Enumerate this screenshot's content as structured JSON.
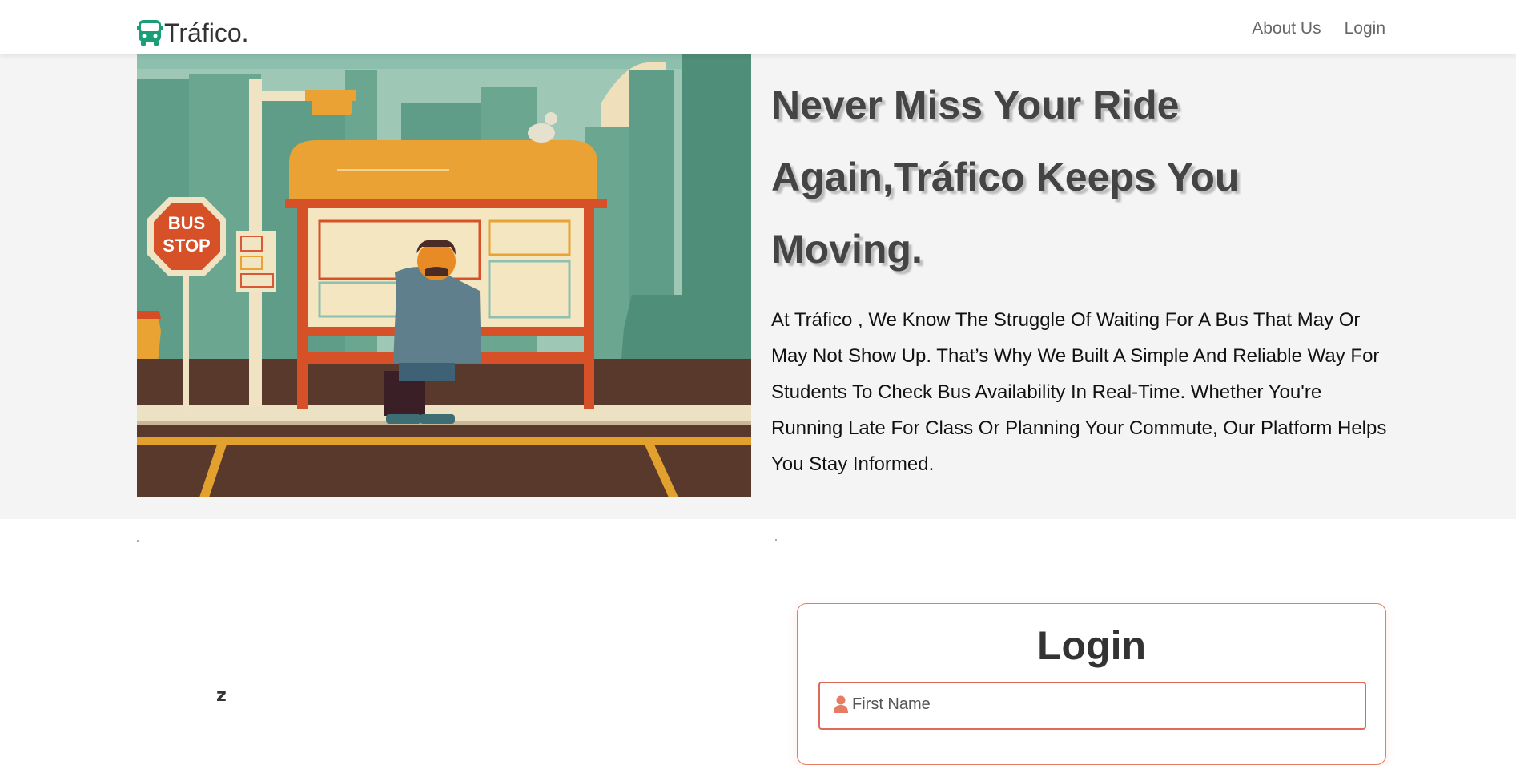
{
  "nav": {
    "brand": "Tráfico.",
    "links": [
      "About Us",
      "Login"
    ]
  },
  "hero": {
    "title": "Never Miss Your Ride Again,Tráfico Keeps You Moving.",
    "description": "At Tráfico , We Know The Struggle Of Waiting For A Bus That May Or May Not Show Up. That’s Why We Built A Simple And Reliable Way For Students To Check Bus Availability In Real-Time. Whether You're Running Late For Class Or Planning Your Commute, Our Platform Helps You Stay Informed.",
    "illustration_sign": [
      "BUS",
      "STOP"
    ]
  },
  "login": {
    "title": "Login",
    "first_name_placeholder": "First Name"
  },
  "partial_glyph": "z",
  "icons": {
    "brand": "bus-icon",
    "field": "user-icon"
  },
  "colors": {
    "brand_icon": "#1a9e78",
    "accent": "#e57c63",
    "title_text": "#444444",
    "hero_bg": "#f4f4f4"
  }
}
